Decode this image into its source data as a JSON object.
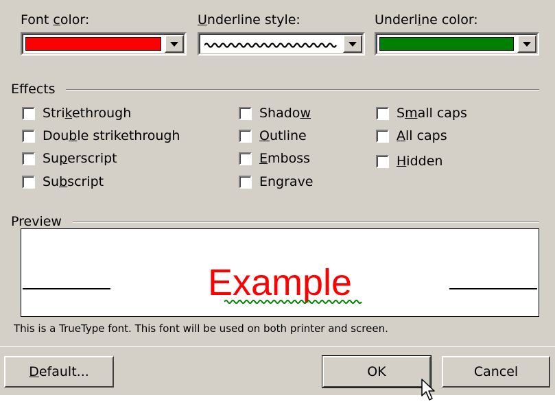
{
  "font_color": {
    "label_pre": "Font ",
    "label_u": "c",
    "label_post": "olor:",
    "color": "#ff0000"
  },
  "underline_style": {
    "label_u": "U",
    "label_post": "nderline style:"
  },
  "underline_color": {
    "label_pre": "Underl",
    "label_u": "i",
    "label_post": "ne color:",
    "color": "#008000"
  },
  "effects": {
    "title": "Effects",
    "items": [
      {
        "pre": "Stri",
        "u": "k",
        "post": "ethrough",
        "checked": false
      },
      {
        "pre": "Dou",
        "u": "b",
        "post": "le strikethrough",
        "checked": false
      },
      {
        "pre": "Su",
        "u": "p",
        "post": "erscript",
        "checked": false
      },
      {
        "pre": "Su",
        "u": "b",
        "post": "script",
        "checked": false
      },
      {
        "pre": "Shado",
        "u": "w",
        "post": "",
        "checked": false
      },
      {
        "pre": "",
        "u": "O",
        "post": "utline",
        "checked": false
      },
      {
        "pre": "",
        "u": "E",
        "post": "mboss",
        "checked": false
      },
      {
        "pre": "En",
        "u": "g",
        "post": "rave",
        "checked": false
      },
      {
        "pre": "S",
        "u": "m",
        "post": "all caps",
        "checked": false
      },
      {
        "pre": "",
        "u": "A",
        "post": "ll caps",
        "checked": false
      },
      {
        "pre": "",
        "u": "H",
        "post": "idden",
        "checked": false
      }
    ]
  },
  "preview": {
    "title": "Preview",
    "sample_text": "Example",
    "sample_color": "#ff0000",
    "underline_color": "#008000",
    "info": "This is a TrueType font. This font will be used on both printer and screen."
  },
  "buttons": {
    "default": {
      "u": "D",
      "post": "efault..."
    },
    "ok": "OK",
    "cancel": "Cancel"
  }
}
